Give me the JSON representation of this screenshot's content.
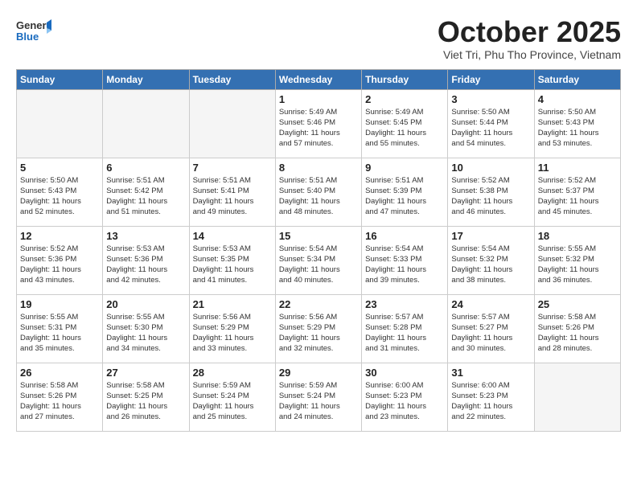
{
  "header": {
    "logo_line1": "General",
    "logo_line2": "Blue",
    "month": "October 2025",
    "location": "Viet Tri, Phu Tho Province, Vietnam"
  },
  "weekdays": [
    "Sunday",
    "Monday",
    "Tuesday",
    "Wednesday",
    "Thursday",
    "Friday",
    "Saturday"
  ],
  "weeks": [
    [
      {
        "day": "",
        "info": ""
      },
      {
        "day": "",
        "info": ""
      },
      {
        "day": "",
        "info": ""
      },
      {
        "day": "1",
        "info": "Sunrise: 5:49 AM\nSunset: 5:46 PM\nDaylight: 11 hours\nand 57 minutes."
      },
      {
        "day": "2",
        "info": "Sunrise: 5:49 AM\nSunset: 5:45 PM\nDaylight: 11 hours\nand 55 minutes."
      },
      {
        "day": "3",
        "info": "Sunrise: 5:50 AM\nSunset: 5:44 PM\nDaylight: 11 hours\nand 54 minutes."
      },
      {
        "day": "4",
        "info": "Sunrise: 5:50 AM\nSunset: 5:43 PM\nDaylight: 11 hours\nand 53 minutes."
      }
    ],
    [
      {
        "day": "5",
        "info": "Sunrise: 5:50 AM\nSunset: 5:43 PM\nDaylight: 11 hours\nand 52 minutes."
      },
      {
        "day": "6",
        "info": "Sunrise: 5:51 AM\nSunset: 5:42 PM\nDaylight: 11 hours\nand 51 minutes."
      },
      {
        "day": "7",
        "info": "Sunrise: 5:51 AM\nSunset: 5:41 PM\nDaylight: 11 hours\nand 49 minutes."
      },
      {
        "day": "8",
        "info": "Sunrise: 5:51 AM\nSunset: 5:40 PM\nDaylight: 11 hours\nand 48 minutes."
      },
      {
        "day": "9",
        "info": "Sunrise: 5:51 AM\nSunset: 5:39 PM\nDaylight: 11 hours\nand 47 minutes."
      },
      {
        "day": "10",
        "info": "Sunrise: 5:52 AM\nSunset: 5:38 PM\nDaylight: 11 hours\nand 46 minutes."
      },
      {
        "day": "11",
        "info": "Sunrise: 5:52 AM\nSunset: 5:37 PM\nDaylight: 11 hours\nand 45 minutes."
      }
    ],
    [
      {
        "day": "12",
        "info": "Sunrise: 5:52 AM\nSunset: 5:36 PM\nDaylight: 11 hours\nand 43 minutes."
      },
      {
        "day": "13",
        "info": "Sunrise: 5:53 AM\nSunset: 5:36 PM\nDaylight: 11 hours\nand 42 minutes."
      },
      {
        "day": "14",
        "info": "Sunrise: 5:53 AM\nSunset: 5:35 PM\nDaylight: 11 hours\nand 41 minutes."
      },
      {
        "day": "15",
        "info": "Sunrise: 5:54 AM\nSunset: 5:34 PM\nDaylight: 11 hours\nand 40 minutes."
      },
      {
        "day": "16",
        "info": "Sunrise: 5:54 AM\nSunset: 5:33 PM\nDaylight: 11 hours\nand 39 minutes."
      },
      {
        "day": "17",
        "info": "Sunrise: 5:54 AM\nSunset: 5:32 PM\nDaylight: 11 hours\nand 38 minutes."
      },
      {
        "day": "18",
        "info": "Sunrise: 5:55 AM\nSunset: 5:32 PM\nDaylight: 11 hours\nand 36 minutes."
      }
    ],
    [
      {
        "day": "19",
        "info": "Sunrise: 5:55 AM\nSunset: 5:31 PM\nDaylight: 11 hours\nand 35 minutes."
      },
      {
        "day": "20",
        "info": "Sunrise: 5:55 AM\nSunset: 5:30 PM\nDaylight: 11 hours\nand 34 minutes."
      },
      {
        "day": "21",
        "info": "Sunrise: 5:56 AM\nSunset: 5:29 PM\nDaylight: 11 hours\nand 33 minutes."
      },
      {
        "day": "22",
        "info": "Sunrise: 5:56 AM\nSunset: 5:29 PM\nDaylight: 11 hours\nand 32 minutes."
      },
      {
        "day": "23",
        "info": "Sunrise: 5:57 AM\nSunset: 5:28 PM\nDaylight: 11 hours\nand 31 minutes."
      },
      {
        "day": "24",
        "info": "Sunrise: 5:57 AM\nSunset: 5:27 PM\nDaylight: 11 hours\nand 30 minutes."
      },
      {
        "day": "25",
        "info": "Sunrise: 5:58 AM\nSunset: 5:26 PM\nDaylight: 11 hours\nand 28 minutes."
      }
    ],
    [
      {
        "day": "26",
        "info": "Sunrise: 5:58 AM\nSunset: 5:26 PM\nDaylight: 11 hours\nand 27 minutes."
      },
      {
        "day": "27",
        "info": "Sunrise: 5:58 AM\nSunset: 5:25 PM\nDaylight: 11 hours\nand 26 minutes."
      },
      {
        "day": "28",
        "info": "Sunrise: 5:59 AM\nSunset: 5:24 PM\nDaylight: 11 hours\nand 25 minutes."
      },
      {
        "day": "29",
        "info": "Sunrise: 5:59 AM\nSunset: 5:24 PM\nDaylight: 11 hours\nand 24 minutes."
      },
      {
        "day": "30",
        "info": "Sunrise: 6:00 AM\nSunset: 5:23 PM\nDaylight: 11 hours\nand 23 minutes."
      },
      {
        "day": "31",
        "info": "Sunrise: 6:00 AM\nSunset: 5:23 PM\nDaylight: 11 hours\nand 22 minutes."
      },
      {
        "day": "",
        "info": ""
      }
    ]
  ]
}
